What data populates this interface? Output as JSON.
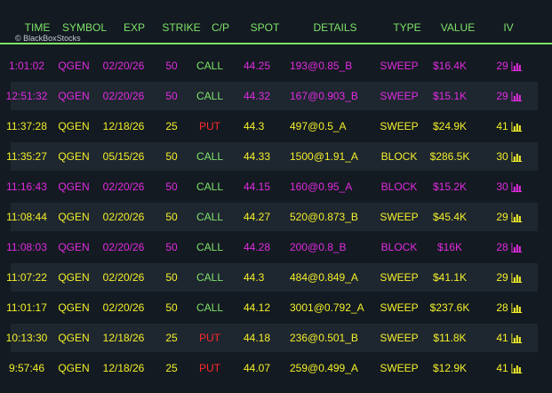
{
  "header": {
    "columns": [
      "TIME",
      "SYMBOL",
      "EXP",
      "STRIKE",
      "C/P",
      "SPOT",
      "DETAILS",
      "TYPE",
      "VALUE",
      "IV"
    ],
    "watermark": "© BlackBoxStocks"
  },
  "colors": {
    "header": "#7ee26a",
    "yellow": "#f4f02a",
    "magenta": "#e12be0",
    "call": "#7ee26a",
    "put": "#ff2a2a"
  },
  "rows": [
    {
      "color": "magenta",
      "time": "1:01:02",
      "symbol": "QGEN",
      "exp": "02/20/26",
      "strike": "50",
      "cp": "CALL",
      "spot": "44.25",
      "details": "193@0.85_B",
      "type": "SWEEP",
      "value": "$16.4K",
      "iv": "29",
      "icon": "bar-chart-icon"
    },
    {
      "color": "magenta",
      "time": "12:51:32",
      "symbol": "QGEN",
      "exp": "02/20/26",
      "strike": "50",
      "cp": "CALL",
      "spot": "44.32",
      "details": "167@0.903_B",
      "type": "SWEEP",
      "value": "$15.1K",
      "iv": "29",
      "icon": "bar-chart-icon"
    },
    {
      "color": "yellow",
      "time": "11:37:28",
      "symbol": "QGEN",
      "exp": "12/18/26",
      "strike": "25",
      "cp": "PUT",
      "spot": "44.3",
      "details": "497@0.5_A",
      "type": "SWEEP",
      "value": "$24.9K",
      "iv": "41",
      "icon": "bar-chart-icon"
    },
    {
      "color": "yellow",
      "time": "11:35:27",
      "symbol": "QGEN",
      "exp": "05/15/26",
      "strike": "50",
      "cp": "CALL",
      "spot": "44.33",
      "details": "1500@1.91_A",
      "type": "BLOCK",
      "value": "$286.5K",
      "iv": "30",
      "icon": "bar-chart-icon"
    },
    {
      "color": "magenta",
      "time": "11:16:43",
      "symbol": "QGEN",
      "exp": "02/20/26",
      "strike": "50",
      "cp": "CALL",
      "spot": "44.15",
      "details": "160@0.95_A",
      "type": "BLOCK",
      "value": "$15.2K",
      "iv": "30",
      "icon": "bar-chart-icon"
    },
    {
      "color": "yellow",
      "time": "11:08:44",
      "symbol": "QGEN",
      "exp": "02/20/26",
      "strike": "50",
      "cp": "CALL",
      "spot": "44.27",
      "details": "520@0.873_B",
      "type": "SWEEP",
      "value": "$45.4K",
      "iv": "29",
      "icon": "bar-chart-icon"
    },
    {
      "color": "magenta",
      "time": "11:08:03",
      "symbol": "QGEN",
      "exp": "02/20/26",
      "strike": "50",
      "cp": "CALL",
      "spot": "44.28",
      "details": "200@0.8_B",
      "type": "BLOCK",
      "value": "$16K",
      "iv": "28",
      "icon": "bar-chart-icon"
    },
    {
      "color": "yellow",
      "time": "11:07:22",
      "symbol": "QGEN",
      "exp": "02/20/26",
      "strike": "50",
      "cp": "CALL",
      "spot": "44.3",
      "details": "484@0.849_A",
      "type": "SWEEP",
      "value": "$41.1K",
      "iv": "29",
      "icon": "bar-chart-icon"
    },
    {
      "color": "yellow",
      "time": "11:01:17",
      "symbol": "QGEN",
      "exp": "02/20/26",
      "strike": "50",
      "cp": "CALL",
      "spot": "44.12",
      "details": "3001@0.792_A",
      "type": "SWEEP",
      "value": "$237.6K",
      "iv": "28",
      "icon": "bar-chart-icon"
    },
    {
      "color": "yellow",
      "time": "10:13:30",
      "symbol": "QGEN",
      "exp": "12/18/26",
      "strike": "25",
      "cp": "PUT",
      "spot": "44.18",
      "details": "236@0.501_B",
      "type": "SWEEP",
      "value": "$11.8K",
      "iv": "41",
      "icon": "bar-chart-icon"
    },
    {
      "color": "yellow",
      "time": "9:57:46",
      "symbol": "QGEN",
      "exp": "12/18/26",
      "strike": "25",
      "cp": "PUT",
      "spot": "44.07",
      "details": "259@0.499_A",
      "type": "SWEEP",
      "value": "$12.9K",
      "iv": "41",
      "icon": "bar-chart-icon"
    }
  ]
}
